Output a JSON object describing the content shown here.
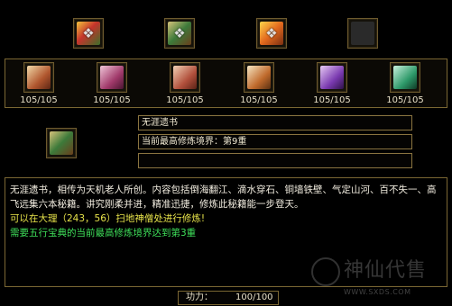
{
  "top_books": [
    {
      "name": "book-red-gold-icon",
      "glyph": "❖"
    },
    {
      "name": "book-green-icon",
      "glyph": "❖"
    },
    {
      "name": "book-orange-icon",
      "glyph": "❖"
    },
    {
      "name": "empty-slot-icon",
      "glyph": ""
    }
  ],
  "scrolls": [
    {
      "name": "scroll-brown-icon",
      "count": "105/105"
    },
    {
      "name": "scroll-pink-icon",
      "count": "105/105"
    },
    {
      "name": "scroll-red-icon",
      "count": "105/105"
    },
    {
      "name": "scroll-tan-icon",
      "count": "105/105"
    },
    {
      "name": "scroll-purple-icon",
      "count": "105/105"
    },
    {
      "name": "scroll-teal-icon",
      "count": "105/105"
    }
  ],
  "selected": {
    "icon": "book-green-icon",
    "name": "无涯遗书",
    "realm": "当前最高修炼境界：第9重",
    "extra": ""
  },
  "description": {
    "intro": "无涯遗书，相传为天机老人所创。内容包括倒海翻江、滴水穿石、铜墙铁壁、气定山河、百不失一、高飞远集六本秘籍。讲究刚柔并进，精准迅捷，修炼此秘籍能一步登天。",
    "location_prefix": "可以在大理（",
    "location_x": "243",
    "location_sep": "，",
    "location_y": "56",
    "location_suffix": "）扫地神僧处进行修炼!",
    "requirement": "需要五行宝典的当前最高修炼境界达到第3重"
  },
  "power": {
    "label": "功力：",
    "value": "100/100"
  },
  "watermark": {
    "title": "神仙代售",
    "url": "WWW.SXDS.COM"
  },
  "colors": {
    "frame": "#7b6733",
    "text_white": "#f2ede0",
    "text_yellow": "#e6e24a",
    "text_green": "#3fe05a"
  }
}
